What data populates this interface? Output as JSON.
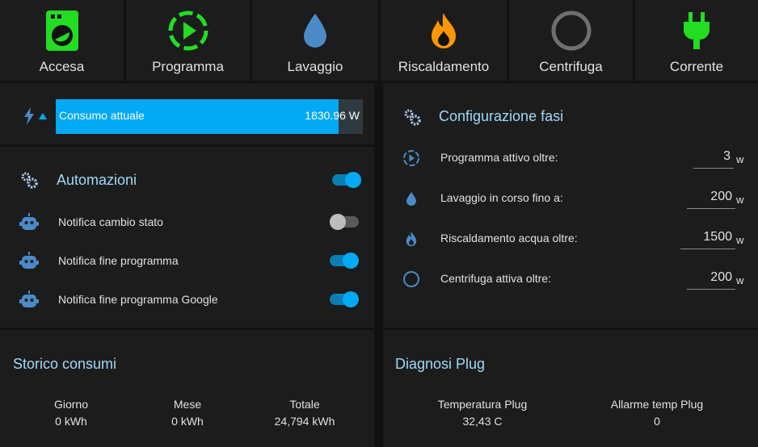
{
  "status_tiles": [
    {
      "label": "Accesa",
      "icon": "washing-machine-icon",
      "color": "#22dd22"
    },
    {
      "label": "Programma",
      "icon": "play-circle-dashed-icon",
      "color": "#22dd22"
    },
    {
      "label": "Lavaggio",
      "icon": "water-drop-icon",
      "color": "#4a8bc7"
    },
    {
      "label": "Riscaldamento",
      "icon": "fire-icon",
      "color": "#ff9800"
    },
    {
      "label": "Centrifuga",
      "icon": "circle-outline-icon",
      "color": "#6f6f6f"
    },
    {
      "label": "Corrente",
      "icon": "power-plug-icon",
      "color": "#22dd22"
    }
  ],
  "power": {
    "name": "Consumo attuale",
    "value": "1830.96 W",
    "fill_fraction": 0.92
  },
  "automations": {
    "title": "Automazioni",
    "master_on": true,
    "items": [
      {
        "label": "Notifica cambio stato",
        "on": false
      },
      {
        "label": "Notifica fine programma",
        "on": true
      },
      {
        "label": "Notifica fine programma Google",
        "on": true
      }
    ]
  },
  "phases": {
    "title": "Configurazione fasi",
    "items": [
      {
        "label": "Programma attivo oltre:",
        "value": "3",
        "unit": "w",
        "icon": "play-circle-dashed-icon"
      },
      {
        "label": "Lavaggio in corso fino a:",
        "value": "200",
        "unit": "w",
        "icon": "water-drop-icon"
      },
      {
        "label": "Riscaldamento acqua oltre:",
        "value": "1500",
        "unit": "w",
        "icon": "fire-icon"
      },
      {
        "label": "Centrifuga attiva oltre:",
        "value": "200",
        "unit": "w",
        "icon": "circle-outline-icon"
      }
    ]
  },
  "history": {
    "title": "Storico consumi",
    "stats": [
      {
        "label": "Giorno",
        "value": "0 kWh"
      },
      {
        "label": "Mese",
        "value": "0 kWh"
      },
      {
        "label": "Totale",
        "value": "24,794 kWh"
      }
    ]
  },
  "diagnostics": {
    "title": "Diagnosi Plug",
    "stats": [
      {
        "label": "Temperatura Plug",
        "value": "32,43 C"
      },
      {
        "label": "Allarme temp Plug",
        "value": "0"
      }
    ]
  },
  "colors": {
    "accent": "#03a9f4",
    "title": "#9fd9f7",
    "icon_blue": "#4a8bc7",
    "green": "#22dd22"
  }
}
